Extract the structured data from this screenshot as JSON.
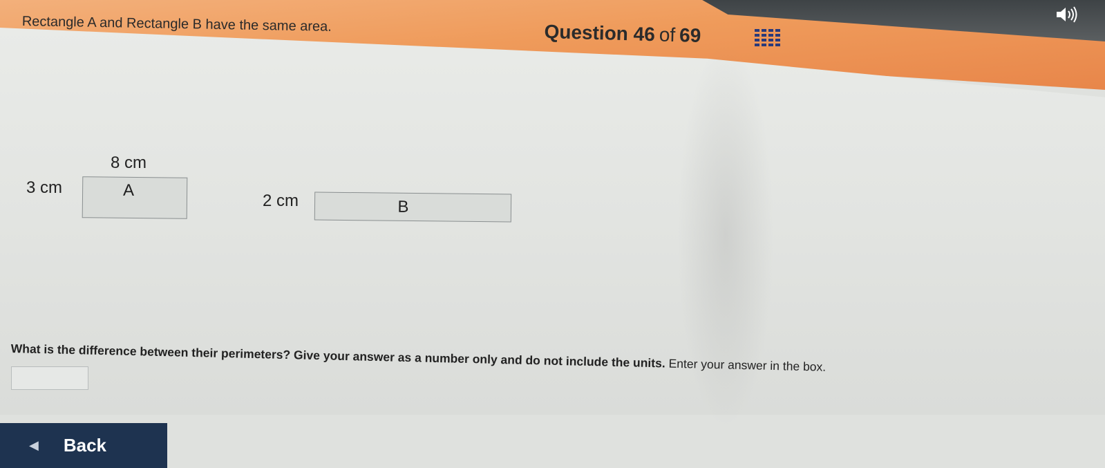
{
  "header": {
    "question_word": "Question",
    "question_number": "46",
    "of_word": "of",
    "total": "69",
    "grid_icon": "question-grid-icon",
    "speaker_icon": "speaker-icon"
  },
  "intro_text": "Rectangle A and Rectangle B have the same area.",
  "rectangle_a": {
    "label": "A",
    "width_label": "8 cm",
    "height_label": "3 cm"
  },
  "rectangle_b": {
    "label": "B",
    "height_label": "2 cm"
  },
  "question": {
    "bold_part": "What is the difference between their perimeters? Give your answer as a number only and do",
    "not_word": "not",
    "rest": "include the units.",
    "plain_part": "Enter your answer in the box."
  },
  "answer": {
    "value": "",
    "placeholder": ""
  },
  "back": {
    "label": "Back",
    "icon": "back-arrow-icon"
  },
  "colors": {
    "header_orange": "#ef9b5b",
    "back_button_bg": "#1e3350",
    "grid_icon": "#2a3a7a"
  }
}
